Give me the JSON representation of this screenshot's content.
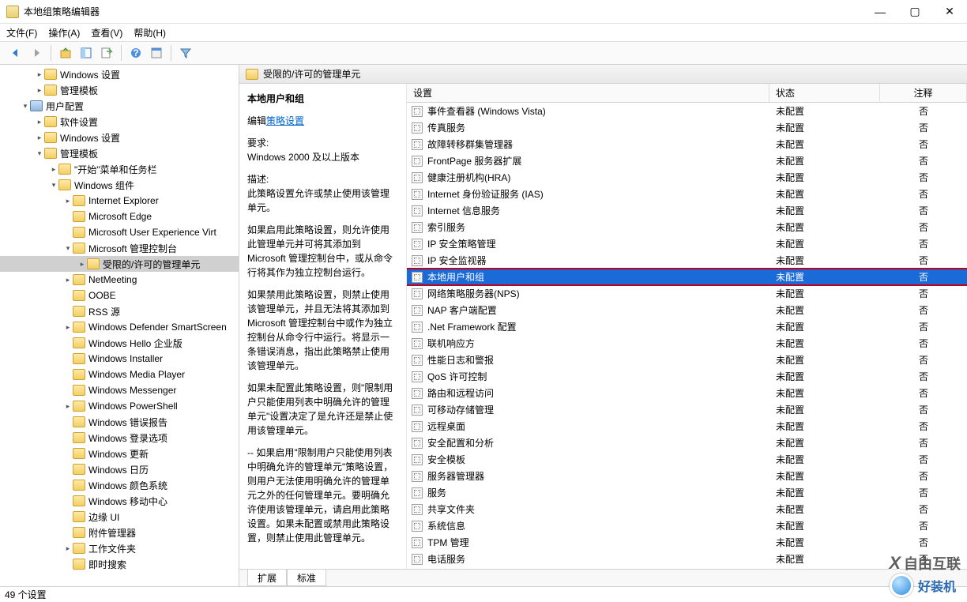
{
  "window": {
    "title": "本地组策略编辑器",
    "minimize": "—",
    "maximize": "▢",
    "close": "✕"
  },
  "menu": [
    "文件(F)",
    "操作(A)",
    "查看(V)",
    "帮助(H)"
  ],
  "header": {
    "path": "受限的/许可的管理单元"
  },
  "desc": {
    "title": "本地用户和组",
    "edit_prefix": "编辑",
    "edit_link": "策略设置",
    "req_label": "要求:",
    "req_value": "Windows 2000 及以上版本",
    "desc_label": "描述:",
    "desc_body": "此策略设置允许或禁止使用该管理单元。",
    "p1": "如果启用此策略设置，则允许使用此管理单元并可将其添加到 Microsoft 管理控制台中，或从命令行将其作为独立控制台运行。",
    "p2": "如果禁用此策略设置，则禁止使用该管理单元，并且无法将其添加到 Microsoft 管理控制台中或作为独立控制台从命令行中运行。将显示一条错误消息，指出此策略禁止使用该管理单元。",
    "p3": "如果未配置此策略设置，则\"限制用户只能使用列表中明确允许的管理单元\"设置决定了是允许还是禁止使用该管理单元。",
    "p4": "-- 如果启用\"限制用户只能使用列表中明确允许的管理单元\"策略设置，则用户无法使用明确允许的管理单元之外的任何管理单元。要明确允许使用该管理单元，请启用此策略设置。如果未配置或禁用此策略设置，则禁止使用此管理单元。"
  },
  "columns": {
    "setting": "设置",
    "state": "状态",
    "note": "注释"
  },
  "state_value": "未配置",
  "note_value": "否",
  "settings": [
    "事件查看器 (Windows Vista)",
    "传真服务",
    "故障转移群集管理器",
    "FrontPage 服务器扩展",
    "健康注册机构(HRA)",
    "Internet 身份验证服务 (IAS)",
    "Internet 信息服务",
    "索引服务",
    "IP 安全策略管理",
    "IP 安全监视器",
    "本地用户和组",
    "网络策略服务器(NPS)",
    "NAP 客户端配置",
    ".Net Framework 配置",
    "联机响应方",
    "性能日志和警报",
    "QoS 许可控制",
    "路由和远程访问",
    "可移动存储管理",
    "远程桌面",
    "安全配置和分析",
    "安全模板",
    "服务器管理器",
    "服务",
    "共享文件夹",
    "系统信息",
    "TPM 管理",
    "电话服务"
  ],
  "selected_index": 10,
  "tree": [
    {
      "indent": 2,
      "chev": "closed",
      "icon": "folder",
      "label": "Windows 设置"
    },
    {
      "indent": 2,
      "chev": "closed",
      "icon": "folder",
      "label": "管理模板"
    },
    {
      "indent": 1,
      "chev": "open",
      "icon": "comp",
      "label": "用户配置"
    },
    {
      "indent": 2,
      "chev": "closed",
      "icon": "folder",
      "label": "软件设置"
    },
    {
      "indent": 2,
      "chev": "closed",
      "icon": "folder",
      "label": "Windows 设置"
    },
    {
      "indent": 2,
      "chev": "open",
      "icon": "folder",
      "label": "管理模板"
    },
    {
      "indent": 3,
      "chev": "closed",
      "icon": "folder",
      "label": "\"开始\"菜单和任务栏"
    },
    {
      "indent": 3,
      "chev": "open",
      "icon": "folder",
      "label": "Windows 组件"
    },
    {
      "indent": 4,
      "chev": "closed",
      "icon": "folder",
      "label": "Internet Explorer"
    },
    {
      "indent": 4,
      "chev": "none",
      "icon": "folder",
      "label": "Microsoft Edge"
    },
    {
      "indent": 4,
      "chev": "none",
      "icon": "folder",
      "label": "Microsoft User Experience Virt"
    },
    {
      "indent": 4,
      "chev": "open",
      "icon": "folder",
      "label": "Microsoft 管理控制台"
    },
    {
      "indent": 5,
      "chev": "closed",
      "icon": "folder",
      "label": "受限的/许可的管理单元",
      "selected": true
    },
    {
      "indent": 4,
      "chev": "closed",
      "icon": "folder",
      "label": "NetMeeting"
    },
    {
      "indent": 4,
      "chev": "none",
      "icon": "folder",
      "label": "OOBE"
    },
    {
      "indent": 4,
      "chev": "none",
      "icon": "folder",
      "label": "RSS 源"
    },
    {
      "indent": 4,
      "chev": "closed",
      "icon": "folder",
      "label": "Windows Defender SmartScreen"
    },
    {
      "indent": 4,
      "chev": "none",
      "icon": "folder",
      "label": "Windows Hello 企业版"
    },
    {
      "indent": 4,
      "chev": "none",
      "icon": "folder",
      "label": "Windows Installer"
    },
    {
      "indent": 4,
      "chev": "none",
      "icon": "folder",
      "label": "Windows Media Player"
    },
    {
      "indent": 4,
      "chev": "none",
      "icon": "folder",
      "label": "Windows Messenger"
    },
    {
      "indent": 4,
      "chev": "closed",
      "icon": "folder",
      "label": "Windows PowerShell"
    },
    {
      "indent": 4,
      "chev": "none",
      "icon": "folder",
      "label": "Windows 错误报告"
    },
    {
      "indent": 4,
      "chev": "none",
      "icon": "folder",
      "label": "Windows 登录选项"
    },
    {
      "indent": 4,
      "chev": "none",
      "icon": "folder",
      "label": "Windows 更新"
    },
    {
      "indent": 4,
      "chev": "none",
      "icon": "folder",
      "label": "Windows 日历"
    },
    {
      "indent": 4,
      "chev": "none",
      "icon": "folder",
      "label": "Windows 颜色系统"
    },
    {
      "indent": 4,
      "chev": "none",
      "icon": "folder",
      "label": "Windows 移动中心"
    },
    {
      "indent": 4,
      "chev": "none",
      "icon": "folder",
      "label": "边缘 UI"
    },
    {
      "indent": 4,
      "chev": "none",
      "icon": "folder",
      "label": "附件管理器"
    },
    {
      "indent": 4,
      "chev": "closed",
      "icon": "folder",
      "label": "工作文件夹"
    },
    {
      "indent": 4,
      "chev": "none",
      "icon": "folder",
      "label": "即时搜索"
    }
  ],
  "tabs": [
    "扩展",
    "标准"
  ],
  "active_tab": 1,
  "status": "49 个设置",
  "watermark1": "自由互联",
  "watermark2": "好装机"
}
